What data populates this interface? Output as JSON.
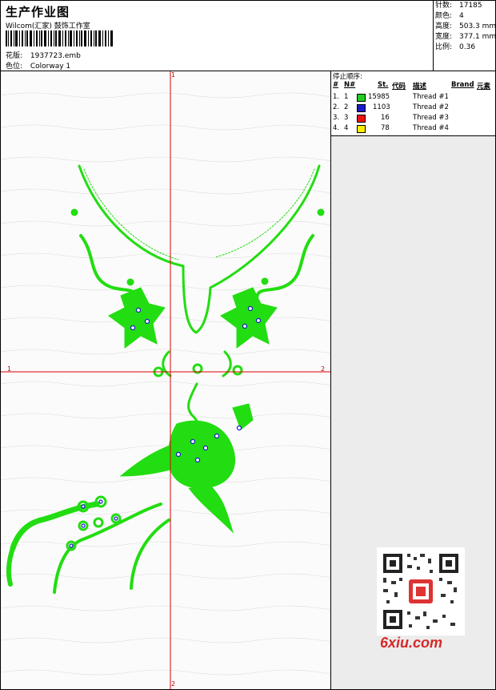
{
  "header": {
    "title": "生产作业图",
    "company": "Wilcom(汇家) 鼓饰工作室",
    "design_label": "花版:",
    "design_value": "1937723.emb",
    "colorway_label": "色位:",
    "colorway_value": "Colorway 1"
  },
  "specs": [
    {
      "label": "针数:",
      "value": "17185"
    },
    {
      "label": "颜色:",
      "value": "4"
    },
    {
      "label": "高度:",
      "value": "503.3 mm"
    },
    {
      "label": "宽度:",
      "value": "377.1 mm"
    },
    {
      "label": "比例:",
      "value": "0.36"
    }
  ],
  "stop_sequence": {
    "title": "停止顺序:",
    "columns": {
      "hash": "#",
      "no": "N#",
      "stitches": "St.",
      "code": "代码",
      "desc": "描述",
      "brand": "Brand",
      "element": "元素"
    },
    "rows": [
      {
        "idx": "1.",
        "n": "1",
        "color": "#22cc22",
        "stitches": "15985",
        "desc": "Thread #1"
      },
      {
        "idx": "2.",
        "n": "2",
        "color": "#1a1acc",
        "stitches": "1103",
        "desc": "Thread #2"
      },
      {
        "idx": "3.",
        "n": "3",
        "color": "#ee1111",
        "stitches": "16",
        "desc": "Thread #3"
      },
      {
        "idx": "4.",
        "n": "4",
        "color": "#ffee00",
        "stitches": "78",
        "desc": "Thread #4"
      }
    ]
  },
  "markers": {
    "top": "1",
    "left": "1",
    "right": "2",
    "bottom": "2"
  },
  "watermark": "6xiu.com",
  "colors": {
    "stitch": "#22dd11",
    "accent": "#1a1acc",
    "guide": "#dd0000"
  }
}
